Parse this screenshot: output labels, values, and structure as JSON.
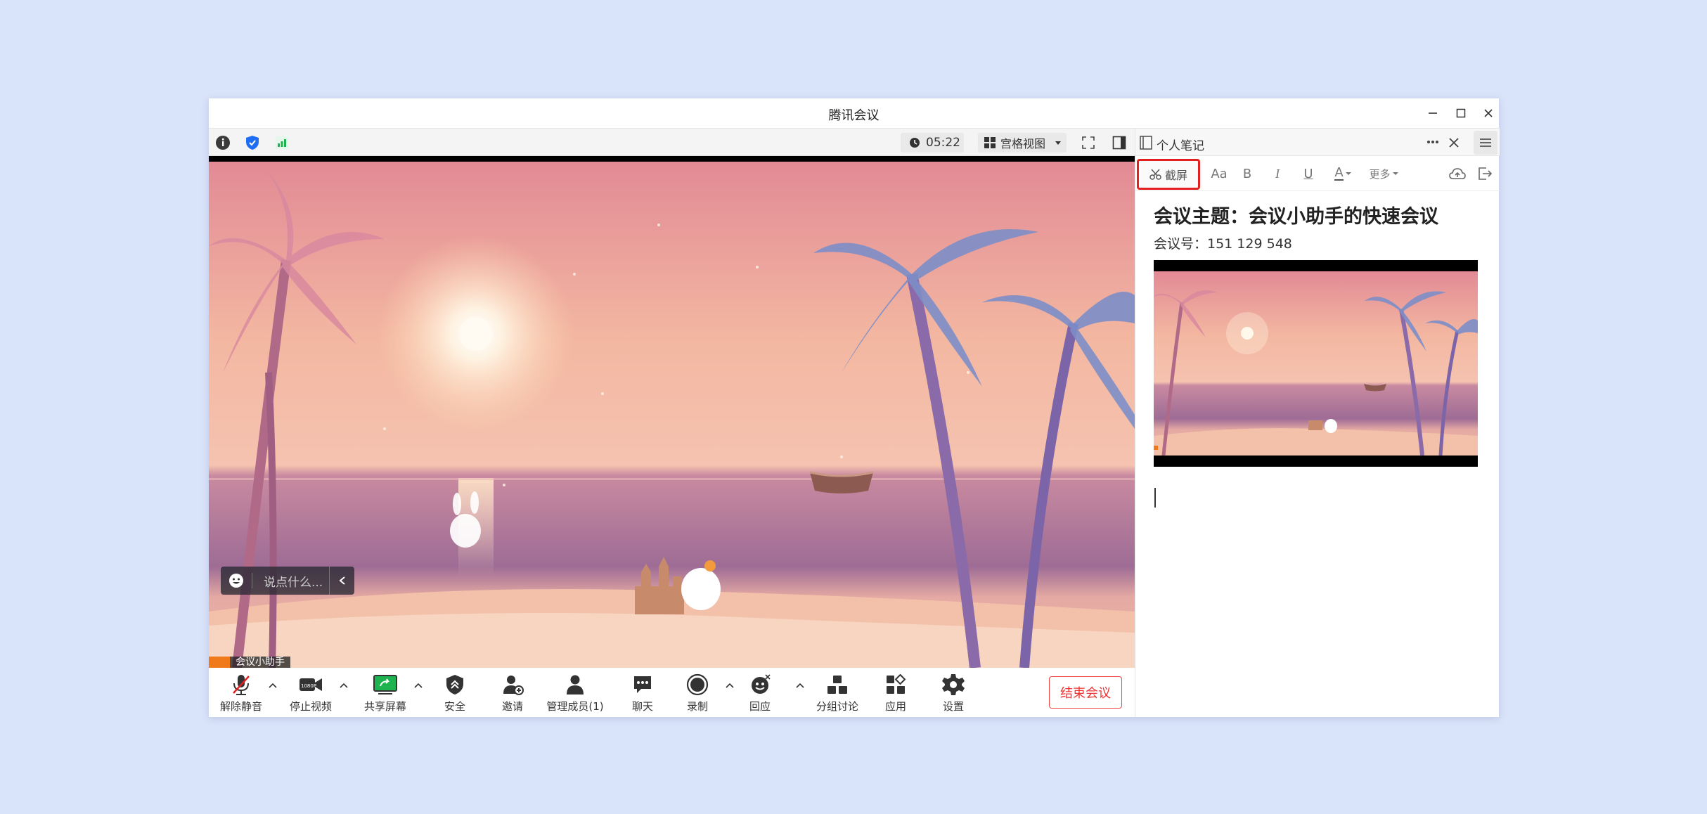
{
  "window": {
    "title": "腾讯会议"
  },
  "topbar": {
    "timer": "05:22",
    "view_mode": "宫格视图"
  },
  "video": {
    "chat_placeholder": "说点什么...",
    "participant_name": "会议小助手"
  },
  "toolbar": {
    "unmute": "解除静音",
    "stop_video": "停止视频",
    "share_screen": "共享屏幕",
    "security": "安全",
    "invite": "邀请",
    "manage_members": "管理成员(1)",
    "chat": "聊天",
    "record": "录制",
    "reaction": "回应",
    "breakout": "分组讨论",
    "apps": "应用",
    "settings": "设置",
    "end_meeting": "结束会议"
  },
  "notes": {
    "title": "个人笔记",
    "format": {
      "screenshot": "截屏",
      "font_size": "Aa",
      "bold": "B",
      "italic": "I",
      "underline": "U",
      "font_color": "A",
      "more": "更多"
    },
    "doc_title": "会议主题：会议小助手的快速会议",
    "meeting_id": "会议号：151 129 548"
  },
  "colors": {
    "accent_red": "#e22020",
    "background": "#d9e3f9",
    "signal_green": "#1db34f",
    "shield_blue": "#1e6df2"
  }
}
